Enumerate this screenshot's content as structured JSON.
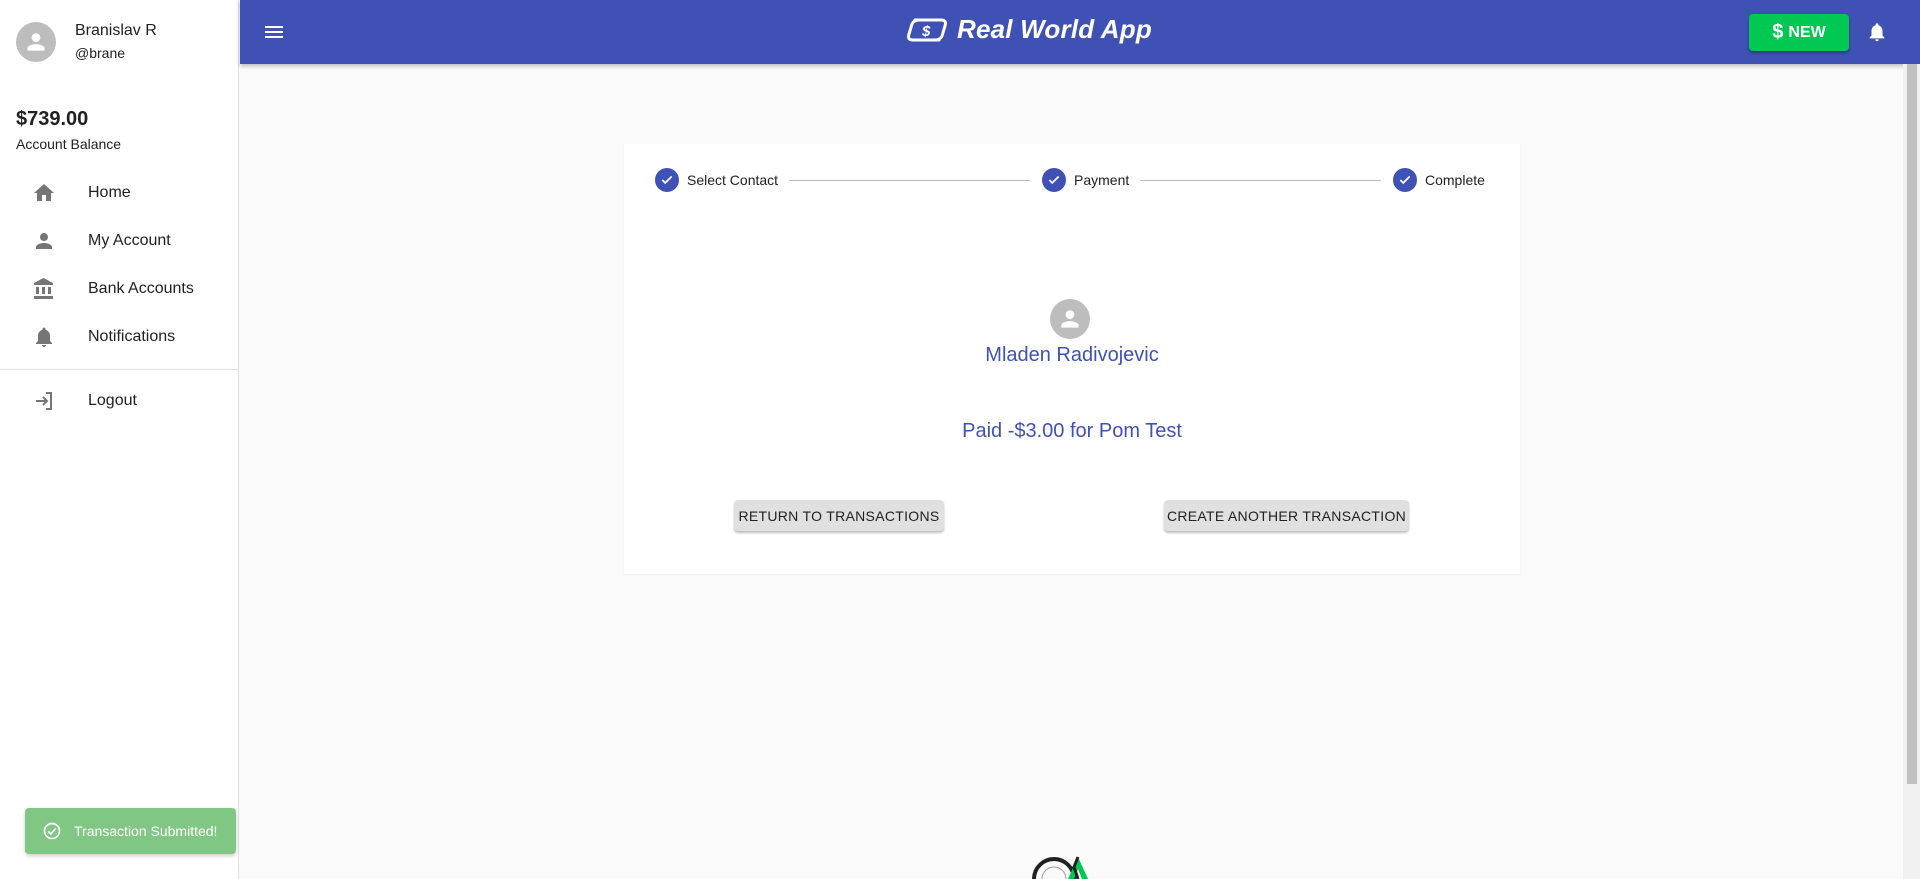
{
  "user": {
    "name": "Branislav R",
    "handle": "@brane"
  },
  "balance": {
    "amount": "$739.00",
    "label": "Account Balance"
  },
  "nav": {
    "items": [
      {
        "label": "Home",
        "icon": "home-icon"
      },
      {
        "label": "My Account",
        "icon": "person-icon"
      },
      {
        "label": "Bank Accounts",
        "icon": "bank-icon"
      },
      {
        "label": "Notifications",
        "icon": "bell-icon"
      }
    ],
    "logout": {
      "label": "Logout",
      "icon": "logout-icon"
    }
  },
  "appbar": {
    "title": "Real World App",
    "new_label": "NEW",
    "new_symbol": "$"
  },
  "stepper": {
    "steps": [
      {
        "label": "Select Contact"
      },
      {
        "label": "Payment"
      },
      {
        "label": "Complete"
      }
    ]
  },
  "transaction": {
    "contact_name": "Mladen Radivojevic",
    "summary": "Paid -$3.00 for Pom Test",
    "return_label": "RETURN TO TRANSACTIONS",
    "create_label": "CREATE ANOTHER TRANSACTION"
  },
  "toast": {
    "message": "Transaction Submitted!"
  },
  "colors": {
    "primary": "#3f51b5",
    "success": "#00c853",
    "toast": "#81c784"
  }
}
